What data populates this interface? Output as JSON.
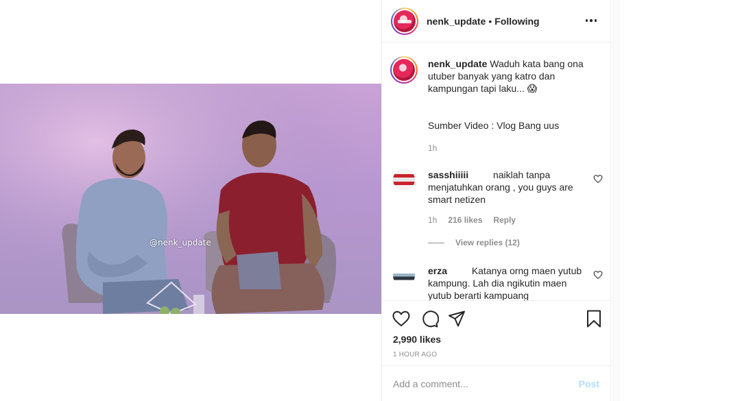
{
  "video": {
    "watermark": "@nenk_update"
  },
  "header": {
    "username": "nenk_update",
    "separator": "•",
    "follow_status": "Following",
    "more_icon": "more-horizontal-icon"
  },
  "caption": {
    "username": "nenk_update",
    "text": "Waduh kata bang ona utuber banyak yang katro dan kampungan tapi laku... 😱",
    "source": "Sumber Video : Vlog Bang uus",
    "time": "1h"
  },
  "comments": [
    {
      "username": "sasshiiiii",
      "text": "naiklah tanpa menjatuhkan orang , you guys are smart netizen",
      "time": "1h",
      "likes": "216 likes",
      "reply_label": "Reply",
      "view_replies": "View replies (12)"
    },
    {
      "username": "erza",
      "text": "Katanya orng maen yutub kampung. Lah dia ngikutin maen yutub berarti kampuang"
    }
  ],
  "actions": {
    "like_icon": "heart-icon",
    "comment_icon": "comment-icon",
    "share_icon": "share-icon",
    "save_icon": "bookmark-icon",
    "likes": "2,990 likes",
    "timestamp": "1 HOUR AGO"
  },
  "add_comment": {
    "placeholder": "Add a comment...",
    "post_label": "Post",
    "post_color": "#b2dffc"
  }
}
